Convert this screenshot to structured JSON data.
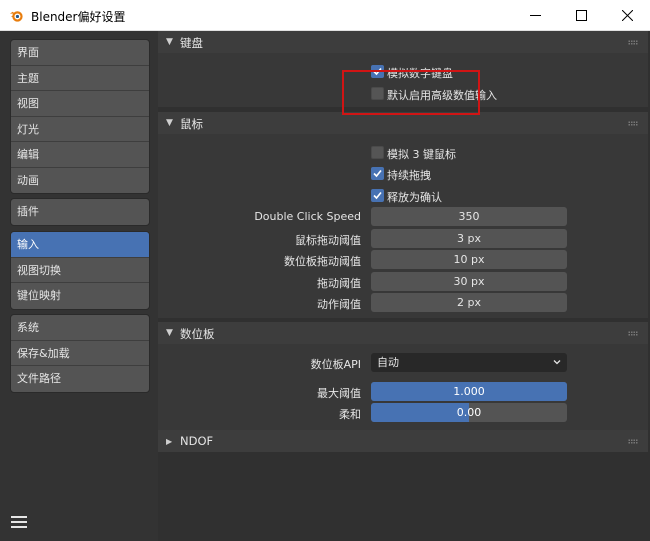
{
  "window": {
    "title": "Blender偏好设置",
    "app_icon": "blender-logo-icon",
    "controls": [
      "minimize-icon",
      "maximize-icon",
      "close-icon"
    ]
  },
  "sidebar": {
    "groups": [
      [
        "界面",
        "主题",
        "视图",
        "灯光",
        "编辑",
        "动画"
      ],
      [
        "插件"
      ],
      [
        "输入",
        "视图切换",
        "键位映射"
      ],
      [
        "系统",
        "保存&加载",
        "文件路径"
      ]
    ],
    "active": "输入",
    "menu_icon": "hamburger-menu-icon"
  },
  "keyboard": {
    "title": "键盘",
    "emulate_numpad": {
      "label": "模拟数字键盘",
      "checked": true
    },
    "default_hq_numeric": {
      "label": "默认启用高级数值输入",
      "checked": false
    }
  },
  "mouse": {
    "title": "鼠标",
    "emulate_3button": {
      "label": "模拟 3 键鼠标",
      "checked": false
    },
    "continuous_grab": {
      "label": "持续拖拽",
      "checked": true
    },
    "release_confirms": {
      "label": "释放为确认",
      "checked": true
    },
    "fields": [
      {
        "label": "Double Click Speed",
        "value": "350"
      },
      {
        "label": "鼠标拖动阈值",
        "value": "3 px"
      },
      {
        "label": "数位板拖动阈值",
        "value": "10 px"
      },
      {
        "label": "拖动阈值",
        "value": "30 px"
      },
      {
        "label": "动作阈值",
        "value": "2 px"
      }
    ]
  },
  "tablet": {
    "title": "数位板",
    "api_label": "数位板API",
    "api_value": "自动",
    "max_threshold": {
      "label": "最大阈值",
      "value": "1.000",
      "fraction": 1.0
    },
    "softness": {
      "label": "柔和",
      "value": "0.00",
      "fraction": 0.5
    }
  },
  "ndof": {
    "title": "NDOF"
  },
  "colors": {
    "accent": "#4772b3",
    "highlight": "#d11414"
  }
}
